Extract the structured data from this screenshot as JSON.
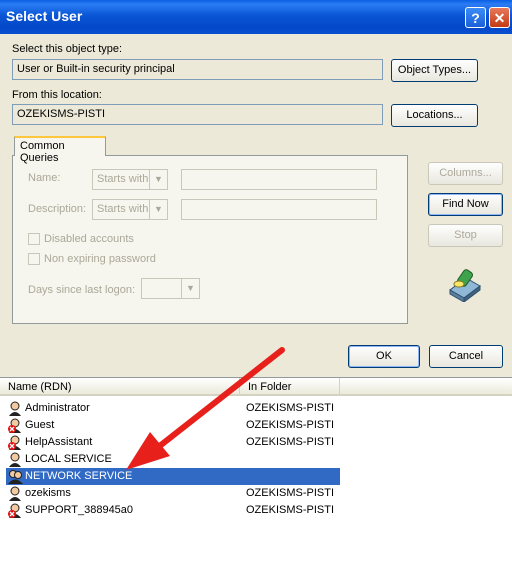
{
  "window": {
    "title": "Select User",
    "help_glyph": "?",
    "close_glyph": "✕"
  },
  "object_type": {
    "label": "Select this object type:",
    "value": "User or Built-in security principal",
    "button": "Object Types..."
  },
  "location": {
    "label": "From this location:",
    "value": "OZEKISMS-PISTI",
    "button": "Locations..."
  },
  "common_queries": {
    "tab_label": "Common Queries",
    "name_label": "Name:",
    "name_match": "Starts with",
    "description_label": "Description:",
    "description_match": "Starts with",
    "disabled_accounts": "Disabled accounts",
    "non_expiring": "Non expiring password",
    "days_label": "Days since last logon:"
  },
  "side_buttons": {
    "columns": "Columns...",
    "find_now": "Find Now",
    "stop": "Stop"
  },
  "dialog_buttons": {
    "ok": "OK",
    "cancel": "Cancel"
  },
  "results": {
    "columns": [
      "Name (RDN)",
      "In Folder"
    ],
    "rows": [
      {
        "name": "Administrator",
        "folder": "OZEKISMS-PISTI",
        "icon": "user-icon"
      },
      {
        "name": "Guest",
        "folder": "OZEKISMS-PISTI",
        "icon": "disabled-user-icon"
      },
      {
        "name": "HelpAssistant",
        "folder": "OZEKISMS-PISTI",
        "icon": "disabled-user-icon"
      },
      {
        "name": "LOCAL SERVICE",
        "folder": "",
        "icon": "user-icon"
      },
      {
        "name": "NETWORK SERVICE",
        "folder": "",
        "icon": "group-icon",
        "selected": true
      },
      {
        "name": "ozekisms",
        "folder": "OZEKISMS-PISTI",
        "icon": "user-icon"
      },
      {
        "name": "SUPPORT_388945a0",
        "folder": "OZEKISMS-PISTI",
        "icon": "disabled-user-icon"
      }
    ]
  },
  "colors": {
    "selection": "#316ac5",
    "annotation_arrow": "#e8201c"
  }
}
